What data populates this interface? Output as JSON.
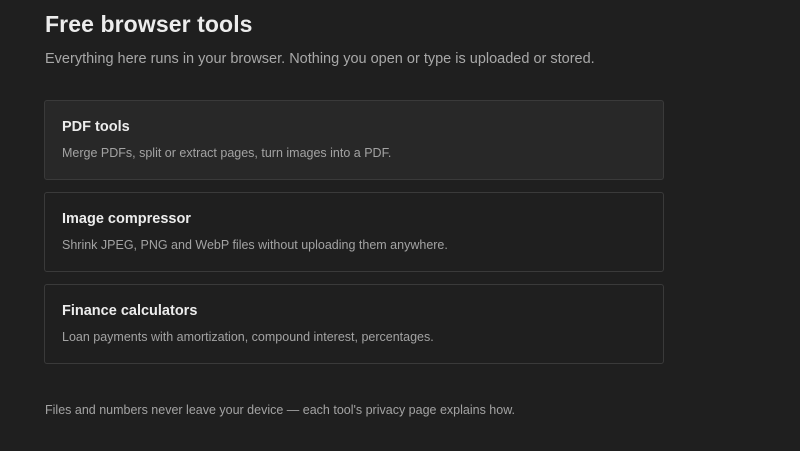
{
  "header": {
    "title": "Free browser tools",
    "subtitle": "Everything here runs in your browser. Nothing you open or type is uploaded or stored."
  },
  "tools": [
    {
      "name": "PDF tools",
      "description": "Merge PDFs, split or extract pages, turn images into a PDF."
    },
    {
      "name": "Image compressor",
      "description": "Shrink JPEG, PNG and WebP files without uploading them anywhere."
    },
    {
      "name": "Finance calculators",
      "description": "Loan payments with amortization, compound interest, percentages."
    }
  ],
  "footer": {
    "note": "Files and numbers never leave your device — each tool's privacy page explains how."
  },
  "colors": {
    "background": "#1f1f1f",
    "card_border": "#3a3a3a",
    "card_hover_background": "#282828",
    "heading_text": "#ececec",
    "muted_text": "#a3a3a3"
  }
}
